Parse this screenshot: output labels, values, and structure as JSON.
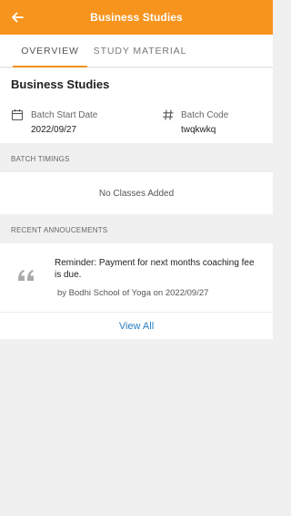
{
  "appbar": {
    "title": "Business Studies",
    "back_icon": "arrow-left-icon",
    "color": "#f7941d"
  },
  "tabs": [
    {
      "label": "OVERVIEW",
      "active": true
    },
    {
      "label": "STUDY MATERIAL",
      "active": false
    }
  ],
  "course": {
    "title": "Business Studies",
    "batch_start_label": "Batch Start Date",
    "batch_start_value": "2022/09/27",
    "batch_start_icon": "calendar-icon",
    "batch_code_label": "Batch Code",
    "batch_code_value": "twqkwkq",
    "batch_code_icon": "hash-icon"
  },
  "batch_timings": {
    "heading": "BATCH TIMINGS",
    "empty_text": "No Classes Added"
  },
  "announcements": {
    "heading": "RECENT ANNOUCEMENTS",
    "items": [
      {
        "text": "Reminder: Payment for next months coaching fee is due.",
        "by": "by Bodhi School of Yoga on 2022/09/27",
        "icon": "quote-icon"
      }
    ],
    "view_all_label": "View All"
  },
  "colors": {
    "accent": "#f7941d",
    "link": "#2a7fc1",
    "background": "#f0f0f0"
  }
}
